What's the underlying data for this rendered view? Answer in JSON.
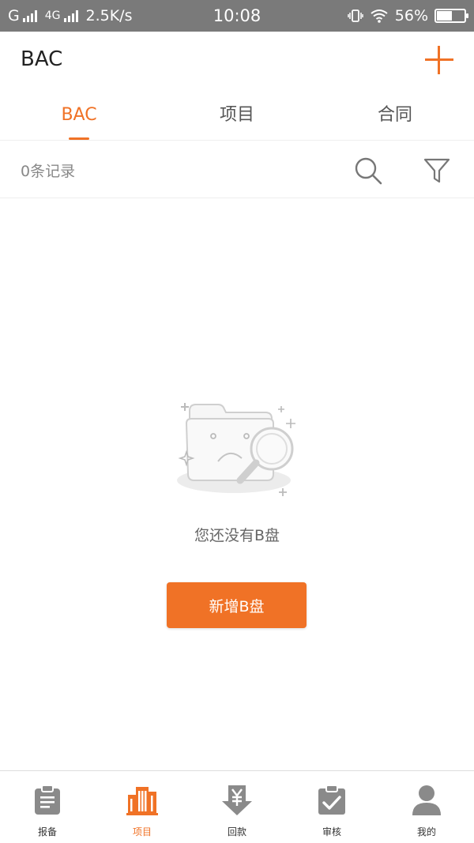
{
  "status_bar": {
    "carrier1": "G",
    "carrier2": "4G",
    "speed": "2.5K/s",
    "time": "10:08",
    "battery": "56%",
    "battery_level": 0.56
  },
  "header": {
    "title": "BAC",
    "add_icon": "plus-icon"
  },
  "tabs": [
    {
      "label": "BAC",
      "active": true
    },
    {
      "label": "项目",
      "active": false
    },
    {
      "label": "合同",
      "active": false
    }
  ],
  "filter_bar": {
    "count": "0条记录",
    "search_icon": "search-icon",
    "filter_icon": "filter-icon"
  },
  "empty_state": {
    "message": "您还没有B盘",
    "button": "新增B盘"
  },
  "bottom_nav": [
    {
      "label": "报备",
      "icon": "clipboard-icon",
      "active": false
    },
    {
      "label": "项目",
      "icon": "buildings-icon",
      "active": true
    },
    {
      "label": "回款",
      "icon": "yen-download-icon",
      "active": false
    },
    {
      "label": "审核",
      "icon": "approval-check-icon",
      "active": false
    },
    {
      "label": "我的",
      "icon": "user-icon",
      "active": false
    }
  ],
  "colors": {
    "accent": "#f07226",
    "status_bar": "#7a7a7a",
    "inactive_icon": "#8a8a8a"
  }
}
